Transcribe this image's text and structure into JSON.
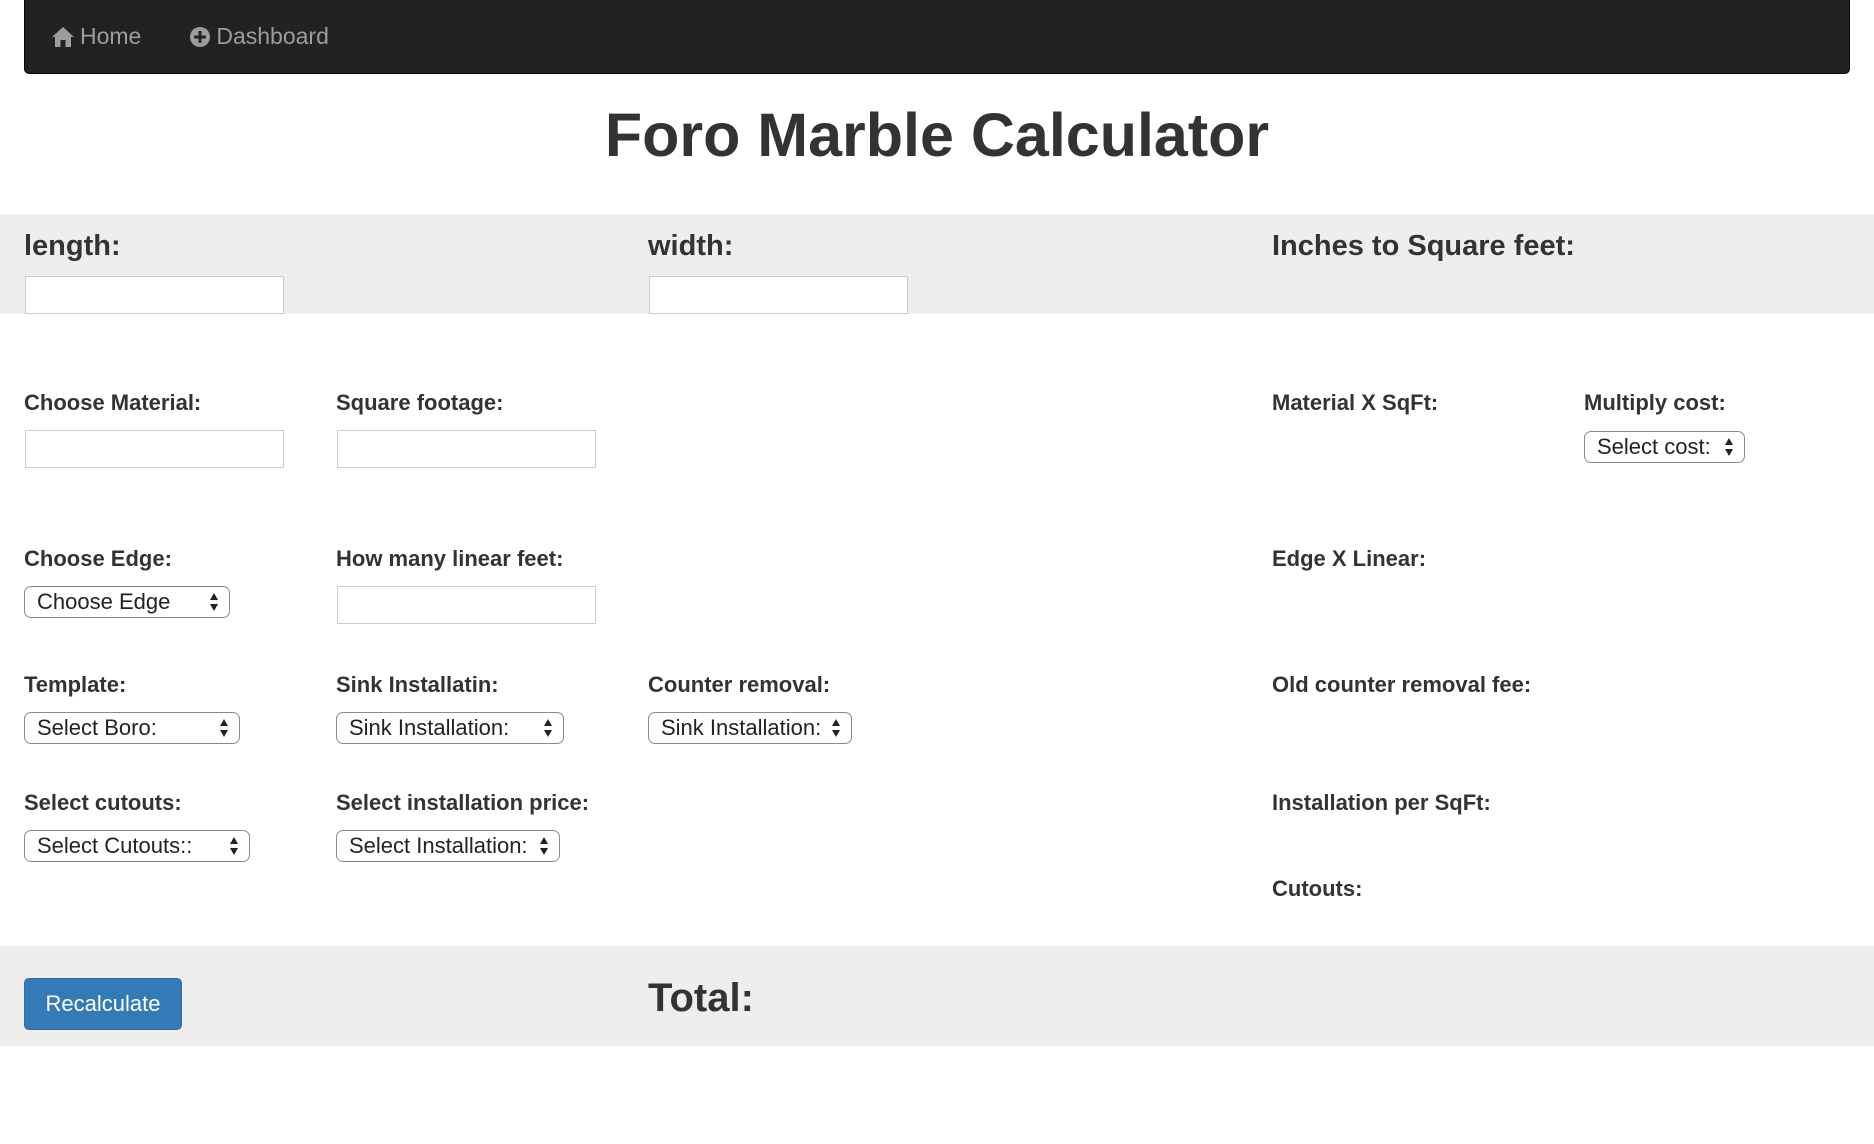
{
  "nav": {
    "home_label": "Home",
    "dashboard_label": "Dashboard"
  },
  "page": {
    "title": "Foro Marble Calculator"
  },
  "dimensions": {
    "length_label": "length:",
    "width_label": "width:",
    "conversion_label": "Inches to Square feet:"
  },
  "form": {
    "material_label": "Choose Material:",
    "square_footage_label": "Square footage:",
    "material_sqft_label": "Material X SqFt:",
    "multiply_cost_label": "Multiply cost:",
    "multiply_cost_select": "Select cost:",
    "edge_label": "Choose Edge:",
    "edge_select": "Choose Edge",
    "linear_feet_label": "How many linear feet:",
    "edge_linear_label": "Edge X Linear:",
    "template_label": "Template:",
    "template_select": "Select Boro:",
    "sink_label": "Sink Installatin:",
    "sink_select": "Sink Installation:",
    "counter_removal_label": "Counter removal:",
    "counter_removal_select": "Sink Installation:",
    "old_counter_fee_label": "Old counter removal fee:",
    "cutouts_label": "Select cutouts:",
    "cutouts_select": "Select Cutouts::",
    "installation_price_label": "Select installation price:",
    "installation_select": "Select Installation:",
    "installation_sqft_label": "Installation per SqFt:",
    "cutouts_result_label": "Cutouts:"
  },
  "footer": {
    "recalculate_label": "Recalculate",
    "total_label": "Total:"
  },
  "colors": {
    "navbar": "#222222",
    "band": "#efeeec",
    "primary_button": "#337ab7"
  }
}
